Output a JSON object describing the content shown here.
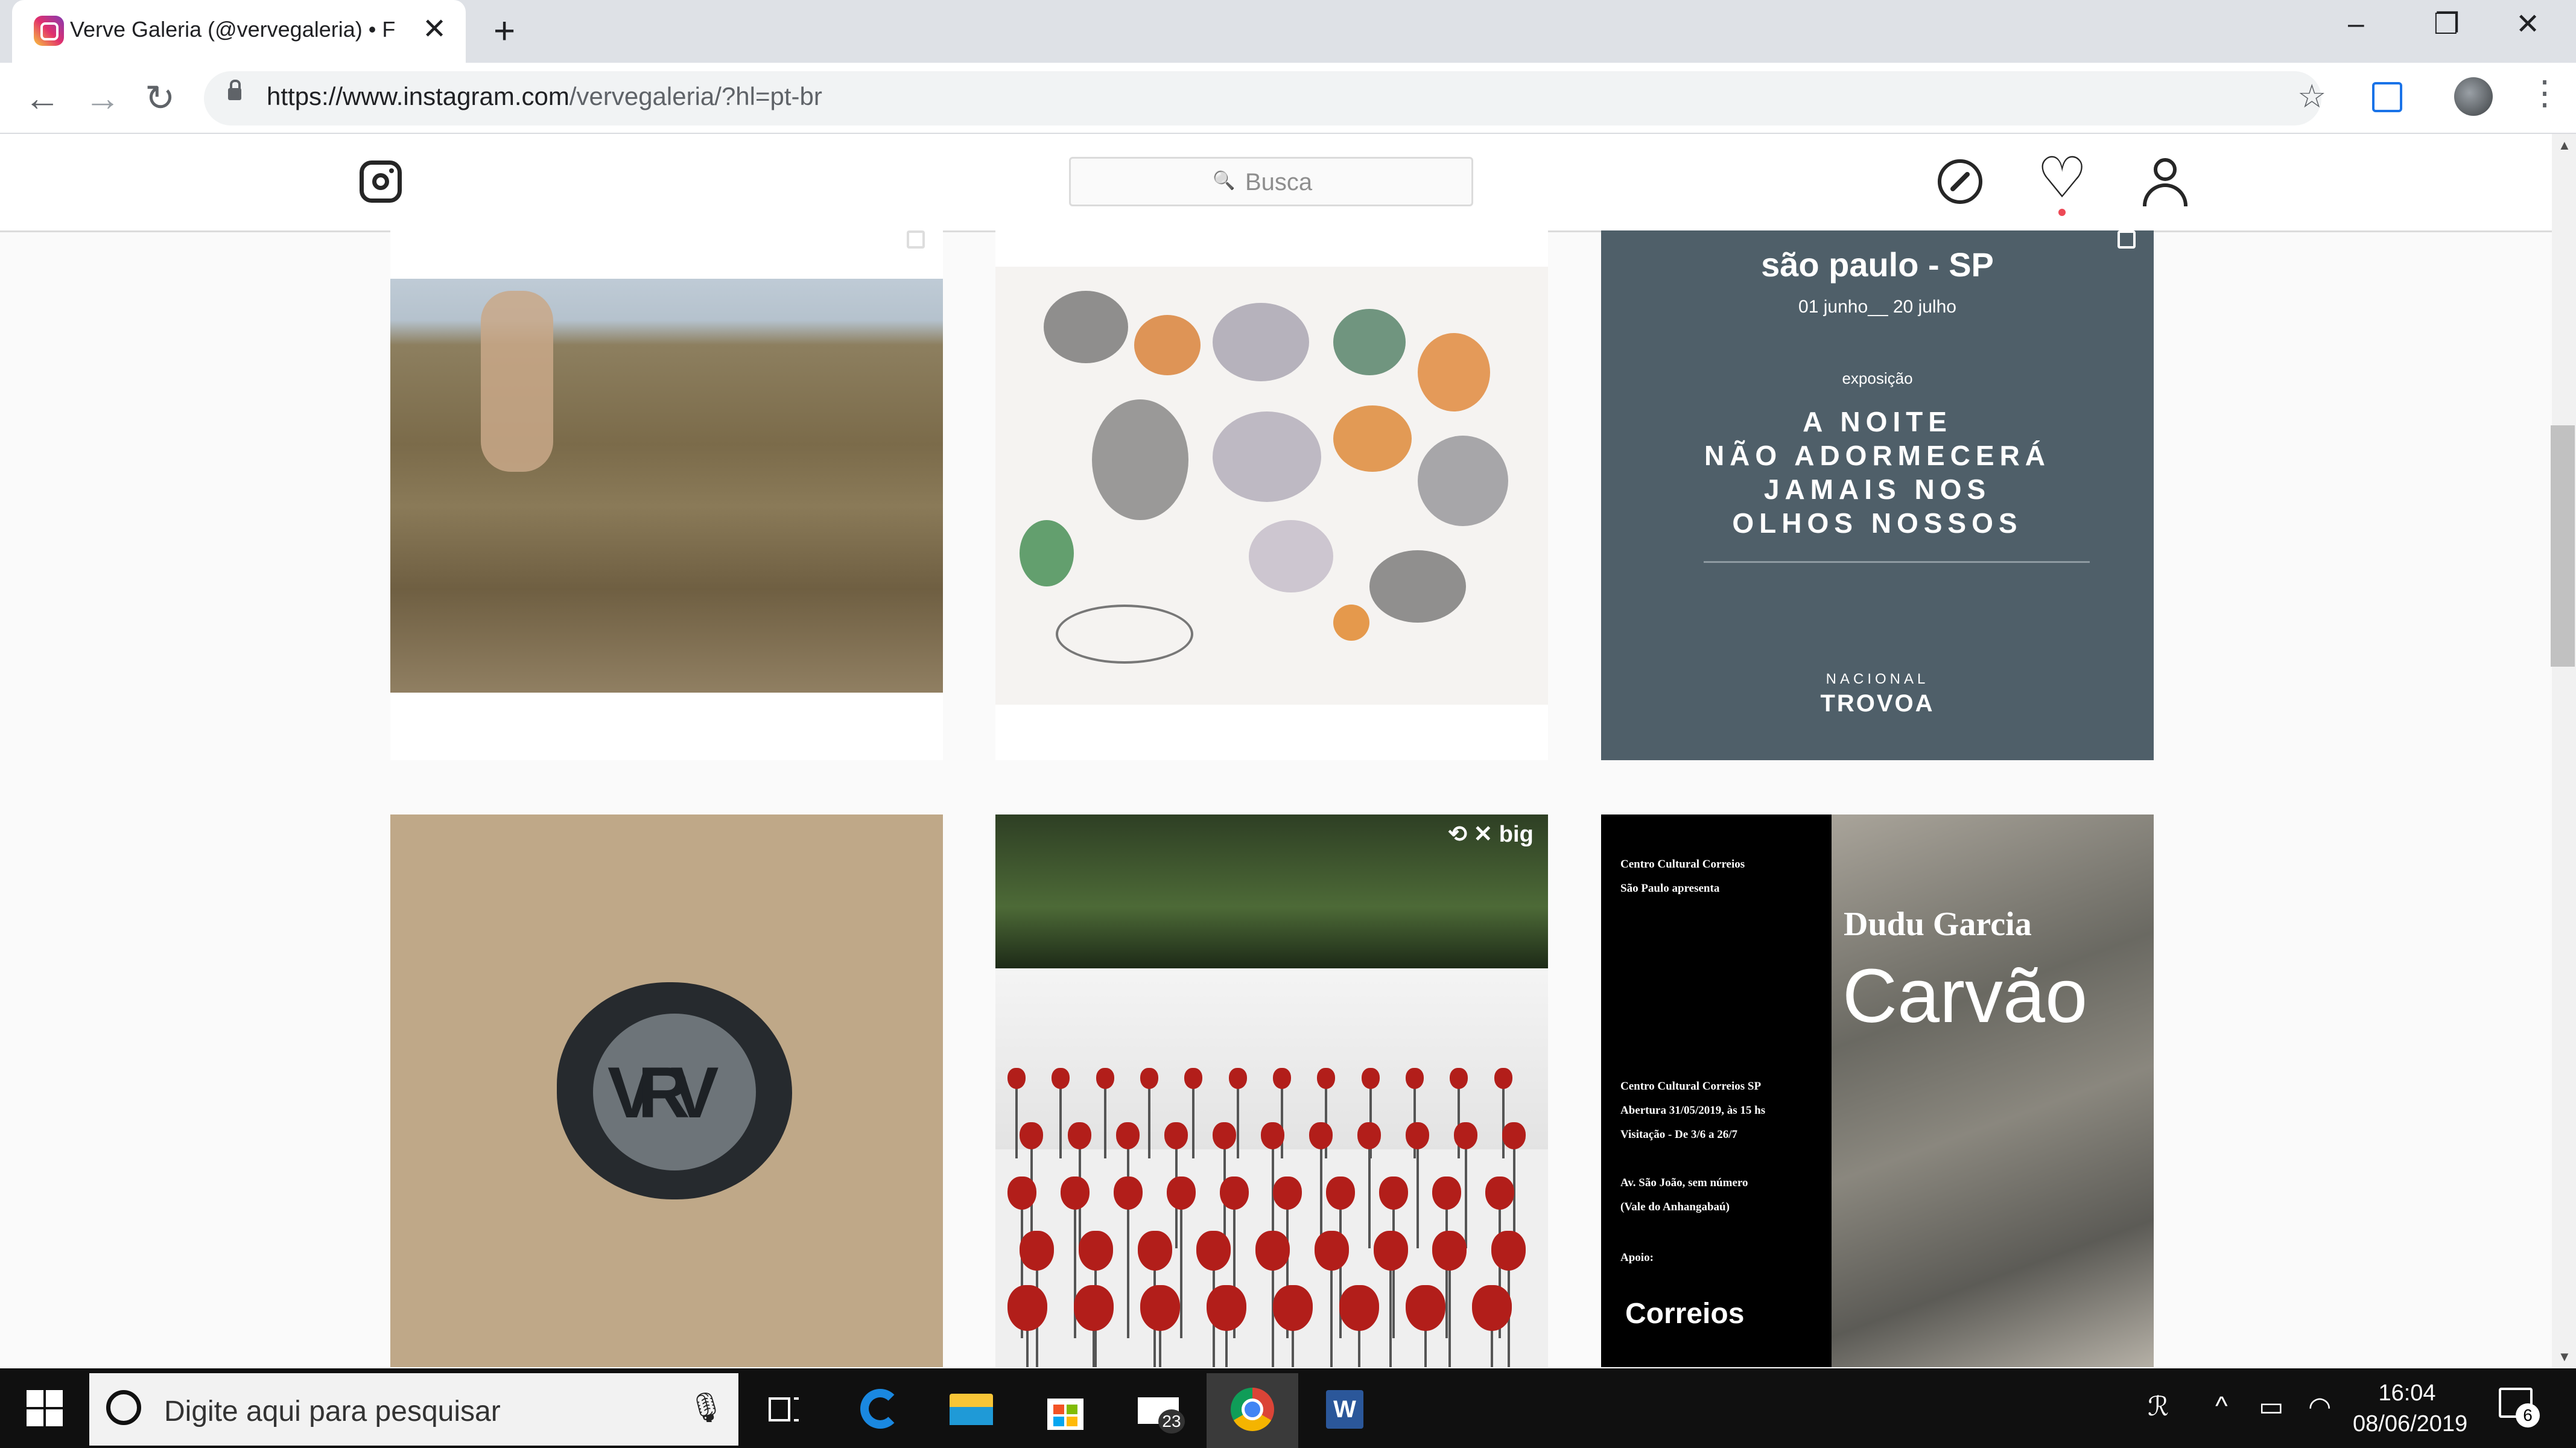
{
  "browser": {
    "tab_title": "Verve Galeria (@vervegaleria) • F",
    "tab_close": "✕",
    "new_tab": "+",
    "url_host": "https://www.instagram.com",
    "url_path": "/vervegaleria/?hl=pt-br",
    "minimize": "–",
    "restore": "❐",
    "close": "✕",
    "back": "←",
    "forward": "→",
    "reload": "↻",
    "bookmark": "☆",
    "menu": "⋮"
  },
  "instagram": {
    "search_placeholder": "Busca",
    "search_icon": "🔍",
    "heart_icon": "♡"
  },
  "posts": {
    "poster": {
      "city": "são paulo - SP",
      "dates": "01 junho__ 20 julho",
      "label": "exposição",
      "line1": "A NOITE",
      "line2": "NÃO ADORMECERÁ",
      "line3": "JAMAIS NOS",
      "line4": "OLHOS NOSSOS",
      "org1": "NACIONAL",
      "org2": "TROVOA"
    },
    "installation_tag": "⟲  ✕ big",
    "flyer": {
      "header1": "Centro Cultural Correios",
      "header2": "São Paulo apresenta",
      "artist": "Dudu Garcia",
      "title": "Carvão",
      "info1": "Centro Cultural Correios SP",
      "info2": "Abertura 31/05/2019, às 15 hs",
      "info3": "Visitação - De 3/6 a 26/7",
      "info4": "Av. São João, sem número",
      "info5": "(Vale do Anhangabaú)",
      "support": "Apoio:",
      "sponsor": "Correios"
    }
  },
  "taskbar": {
    "search_text": "Digite aqui para pesquisar",
    "mail_badge": "23",
    "time": "16:04",
    "date": "08/06/2019",
    "notifications": "6",
    "mic": "🎙",
    "chevron": "^"
  },
  "colors": {
    "poster_bg": "#4f5f69",
    "notification_dot": "#ed4956"
  }
}
